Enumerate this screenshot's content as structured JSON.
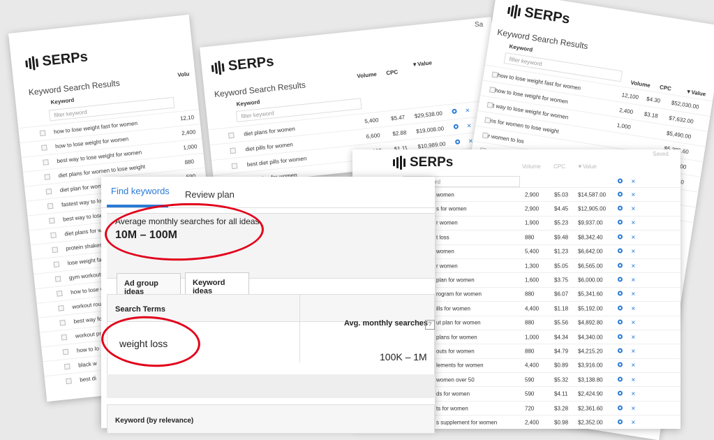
{
  "brand": "SERPs",
  "sheet_title": "Keyword Search Results",
  "columns": {
    "keyword": "Keyword",
    "volume": "Volume",
    "cpc": "CPC",
    "value": "▼Value"
  },
  "filter_placeholder": "filter keyword",
  "left_sheet": {
    "volume_partial": "Volu",
    "rows": [
      {
        "kw": "how to lose weight fast for women",
        "vol": "12,10"
      },
      {
        "kw": "how to lose weight for women",
        "vol": "2,400"
      },
      {
        "kw": "best way to lose weight for women",
        "vol": "1,000"
      },
      {
        "kw": "diet plans for women to lose weight",
        "vol": "880"
      },
      {
        "kw": "diet plan for women to lose weight",
        "vol": "590"
      },
      {
        "kw": "fastest way to lose weig",
        "vol": ""
      },
      {
        "kw": "best way to lose weigh",
        "vol": ""
      },
      {
        "kw": "diet plans for women",
        "vol": ""
      },
      {
        "kw": "protein shakes for w",
        "vol": ""
      },
      {
        "kw": "lose weight fast w",
        "vol": ""
      },
      {
        "kw": "gym workouts fo",
        "vol": ""
      },
      {
        "kw": "how to lose we",
        "vol": ""
      },
      {
        "kw": "workout routi",
        "vol": ""
      },
      {
        "kw": "best way fo",
        "vol": ""
      },
      {
        "kw": "workout pr",
        "vol": ""
      },
      {
        "kw": "how to lo",
        "vol": ""
      },
      {
        "kw": "black w",
        "vol": ""
      },
      {
        "kw": "best di",
        "vol": ""
      }
    ]
  },
  "mid_sheet": {
    "rows": [
      {
        "kw": "diet plans for women",
        "vol": "5,400",
        "cpc": "$5.47",
        "val": "$29,538.00"
      },
      {
        "kw": "diet pills for women",
        "vol": "6,600",
        "cpc": "$2.88",
        "val": "$19,008.00"
      },
      {
        "kw": "best diet pills for women",
        "vol": "9,900",
        "cpc": "$1.11",
        "val": "$10,989.00"
      },
      {
        "kw": "diet plan for women",
        "vol": "4,400",
        "cpc": "$1.65",
        "val": "$7,260.00"
      },
      {
        "kw": "omen",
        "vol": "",
        "cpc": "",
        "val": "$7,241.00"
      }
    ]
  },
  "top_right_sheet": {
    "corner_text": "Sa",
    "rows": [
      {
        "kw": "how to lose weight fast for women",
        "vol": "12,100",
        "cpc": "$4.30",
        "val": "$52,030.00"
      },
      {
        "kw": "how to lose weight for women",
        "vol": "2,400",
        "cpc": "$3.18",
        "val": "$7,632.00"
      },
      {
        "kw": "t way to lose weight for women",
        "vol": "1,000",
        "cpc": "",
        "val": "$5,490.00"
      },
      {
        "kw": "ns for women to lose weight",
        "vol": "",
        "cpc": "",
        "val": "$5,385.60"
      },
      {
        "kw": "r women to los",
        "vol": "",
        "cpc": "",
        "val": "$3,900.00"
      },
      {
        "kw": "",
        "vol": "",
        "cpc": "",
        "val": "$3,898.40"
      },
      {
        "kw": "",
        "vol": "",
        "cpc": "",
        "val": "$15.50"
      },
      {
        "kw": "",
        "vol": "",
        "cpc": "",
        "val": "8.80"
      },
      {
        "kw": "",
        "vol": "",
        "cpc": "",
        "val": "50"
      }
    ]
  },
  "front_sheet": {
    "saved": "Saved",
    "rows": [
      {
        "kw": "women",
        "vol": "2,900",
        "cpc": "$5.03",
        "val": "$14,587.00"
      },
      {
        "kw": "s for women",
        "vol": "2,900",
        "cpc": "$4.45",
        "val": "$12,905.00"
      },
      {
        "kw": "r women",
        "vol": "1,900",
        "cpc": "$5.23",
        "val": "$9,937.00"
      },
      {
        "kw": "t loss",
        "vol": "880",
        "cpc": "$9.48",
        "val": "$8,342.40"
      },
      {
        "kw": "women",
        "vol": "5,400",
        "cpc": "$1.23",
        "val": "$6,642.00"
      },
      {
        "kw": "r women",
        "vol": "1,300",
        "cpc": "$5.05",
        "val": "$6,565.00"
      },
      {
        "kw": "plan for women",
        "vol": "1,600",
        "cpc": "$3.75",
        "val": "$6,000.00"
      },
      {
        "kw": "rogram for women",
        "vol": "880",
        "cpc": "$6.07",
        "val": "$5,341.60"
      },
      {
        "kw": "ills for women",
        "vol": "4,400",
        "cpc": "$1.18",
        "val": "$5,192.00"
      },
      {
        "kw": "ut plan for women",
        "vol": "880",
        "cpc": "$5.56",
        "val": "$4,892.80"
      },
      {
        "kw": "plans for women",
        "vol": "1,000",
        "cpc": "$4.34",
        "val": "$4,340.00"
      },
      {
        "kw": "outs for women",
        "vol": "880",
        "cpc": "$4.79",
        "val": "$4,215.20"
      },
      {
        "kw": "lements for women",
        "vol": "4,400",
        "cpc": "$0.89",
        "val": "$3,916.00"
      },
      {
        "kw": "women over 50",
        "vol": "590",
        "cpc": "$5.32",
        "val": "$3,138.80"
      },
      {
        "kw": "ds for women",
        "vol": "590",
        "cpc": "$4.11",
        "val": "$2,424.90"
      },
      {
        "kw": "ts for women",
        "vol": "720",
        "cpc": "$3.28",
        "val": "$2,361.60"
      },
      {
        "kw": "s supplement for women",
        "vol": "2,400",
        "cpc": "$0.98",
        "val": "$2,352.00"
      }
    ]
  },
  "planner": {
    "tab_find": "Find keywords",
    "tab_review": "Review plan",
    "avg_label": "Average monthly searches for all ideas",
    "avg_value": "10M – 100M",
    "subtab_adgroup": "Ad group ideas",
    "subtab_keyword": "Keyword ideas",
    "col_search_terms": "Search Terms",
    "col_avg": "Avg. monthly searches",
    "help": "?",
    "term": "weight loss",
    "term_value": "100K – 1M",
    "bottom_header": "Keyword (by relevance)"
  },
  "colors": {
    "accent": "#2a7ad6",
    "annotation": "#e2001a"
  }
}
